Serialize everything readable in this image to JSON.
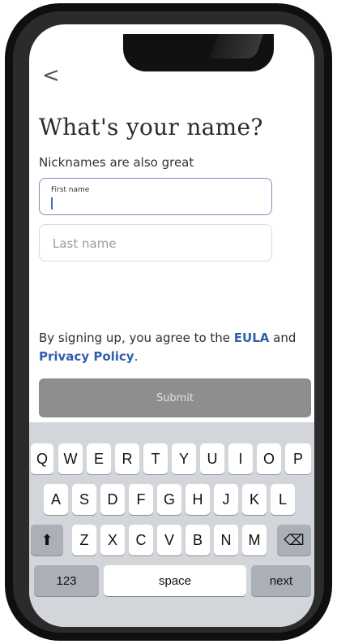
{
  "nav": {
    "back_glyph": "<"
  },
  "page": {
    "title": "What's your name?",
    "subtitle": "Nicknames are also great"
  },
  "form": {
    "first_name_label": "First name",
    "first_name_value": "",
    "last_name_placeholder": "Last name"
  },
  "legal": {
    "prefix": "By signing up, you agree to the ",
    "eula": "EULA",
    "and": " and ",
    "privacy": "Privacy Policy",
    "suffix": "."
  },
  "submit_label": "Submit",
  "keyboard": {
    "row1": [
      "Q",
      "W",
      "E",
      "R",
      "T",
      "Y",
      "U",
      "I",
      "O",
      "P"
    ],
    "row2": [
      "A",
      "S",
      "D",
      "F",
      "G",
      "H",
      "J",
      "K",
      "L"
    ],
    "row3": [
      "Z",
      "X",
      "C",
      "V",
      "B",
      "N",
      "M"
    ],
    "shift_glyph": "⬆",
    "backspace_glyph": "⌫",
    "numbers_label": "123",
    "space_label": "space",
    "next_label": "next"
  },
  "colors": {
    "link": "#2f5fb0",
    "focus_border": "#7f8fb5",
    "submit_bg": "#8e8e8e"
  }
}
